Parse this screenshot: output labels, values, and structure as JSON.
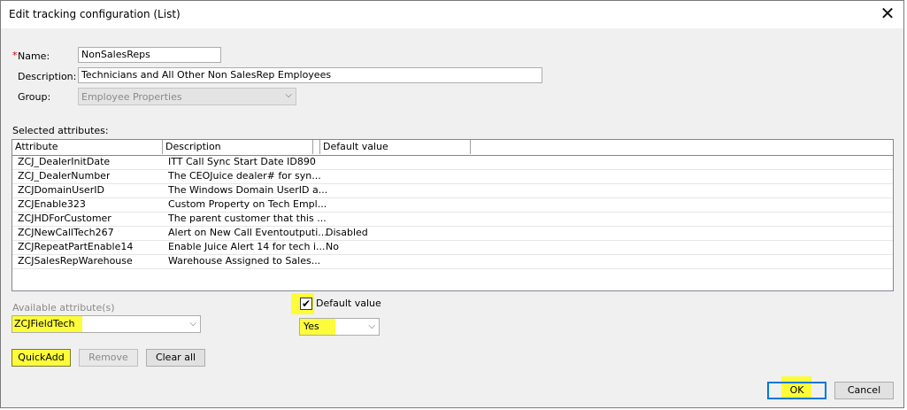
{
  "window": {
    "title": "Edit tracking configuration (List)"
  },
  "form": {
    "required_mark": "*",
    "name_label": "Name:",
    "name_value": "NonSalesReps",
    "description_label": "Description:",
    "description_value": "Technicians and All Other Non SalesRep Employees",
    "group_label": "Group:",
    "group_value": "Employee Properties"
  },
  "selected": {
    "label": "Selected attributes:",
    "columns": [
      "Attribute",
      "Description",
      "Default value"
    ],
    "rows": [
      {
        "attribute": "ZCJ_DealerInitDate",
        "description": "ITT Call Sync Start Date ID890",
        "default": ""
      },
      {
        "attribute": "ZCJ_DealerNumber",
        "description": "The CEOJuice dealer# for syn...",
        "default": ""
      },
      {
        "attribute": "ZCJDomainUserID",
        "description": "The Windows Domain UserID a...",
        "default": ""
      },
      {
        "attribute": "ZCJEnable323",
        "description": "Custom Property on Tech Empl...",
        "default": ""
      },
      {
        "attribute": "ZCJHDForCustomer",
        "description": "The parent customer that this ...",
        "default": ""
      },
      {
        "attribute": "ZCJNewCallTech267",
        "description": "Alert on New Call Eventoutputi...",
        "default": "Disabled"
      },
      {
        "attribute": "ZCJRepeatPartEnable14",
        "description": "Enable Juice Alert 14 for tech i...",
        "default": "No"
      },
      {
        "attribute": "ZCJSalesRepWarehouse",
        "description": "Warehouse Assigned to Sales...",
        "default": ""
      }
    ]
  },
  "available": {
    "label": "Available attribute(s)",
    "value": "ZCJFieldTech"
  },
  "default_value": {
    "label": "Default value",
    "checked": true,
    "value": "Yes"
  },
  "buttons": {
    "quickadd": "QuickAdd",
    "remove": "Remove",
    "clear_all": "Clear all",
    "ok": "OK",
    "cancel": "Cancel"
  },
  "colors": {
    "highlight": "#fcfc3a",
    "required": "#d00000"
  }
}
